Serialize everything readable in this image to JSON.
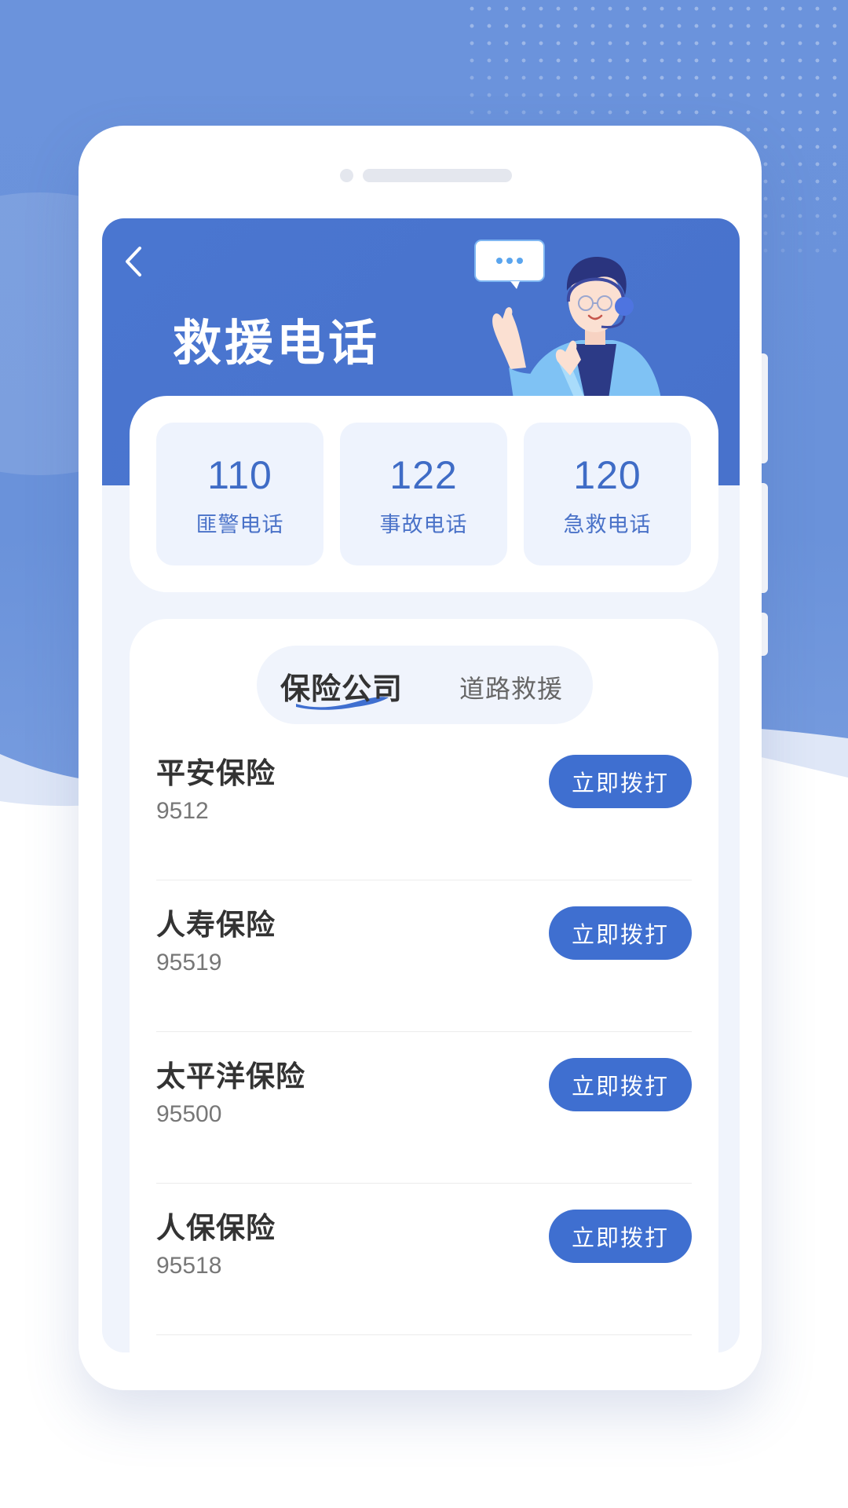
{
  "header": {
    "title": "救援电话"
  },
  "hotlines": [
    {
      "number": "110",
      "label": "匪警电话"
    },
    {
      "number": "122",
      "label": "事故电话"
    },
    {
      "number": "120",
      "label": "急救电话"
    }
  ],
  "tabs": [
    {
      "label": "保险公司",
      "active": true
    },
    {
      "label": "道路救援",
      "active": false
    }
  ],
  "contacts": [
    {
      "name": "平安保险",
      "phone": "9512",
      "button": "立即拨打"
    },
    {
      "name": "人寿保险",
      "phone": "95519",
      "button": "立即拨打"
    },
    {
      "name": "太平洋保险",
      "phone": "95500",
      "button": "立即拨打"
    },
    {
      "name": "人保保险",
      "phone": "95518",
      "button": "立即拨打"
    }
  ],
  "colors": {
    "background": "#6b93dc",
    "hero": "#4a76d0",
    "accent": "#3f6fd0",
    "hotline_box": "#eef3fd"
  },
  "icons": {
    "back": "chevron-left-icon",
    "illustration": "customer-service-agent-illustration",
    "chat": "chat-bubble-icon",
    "headset": "headset-icon"
  }
}
